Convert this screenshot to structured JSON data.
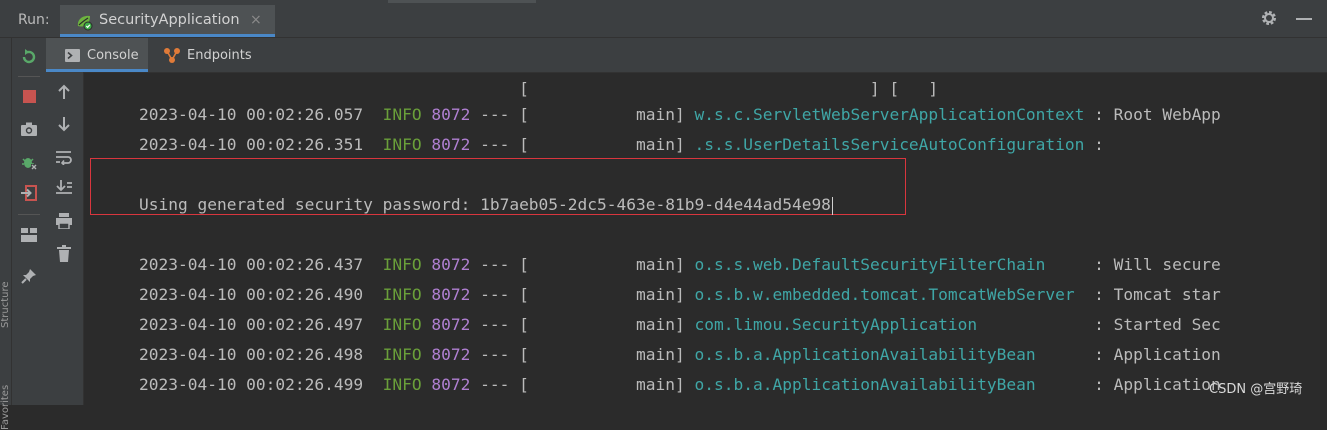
{
  "runbar": {
    "label": "Run:",
    "tab_title": "SecurityApplication",
    "close_glyph": "×"
  },
  "tabs": [
    {
      "label": "Console",
      "icon": "console-icon"
    },
    {
      "label": "Endpoints",
      "icon": "endpoints-icon"
    }
  ],
  "side_labels": [
    "Structure",
    "Favorites"
  ],
  "console": {
    "partial_top_line": "[                                   ] [   ] ",
    "lines": [
      {
        "timestamp": "2023-04-10 00:02:26.057",
        "level": "INFO",
        "pid": "8072",
        "sep": "--- [",
        "thread": "           main]",
        "logger": "w.s.c.ServletWebServerApplicationContext",
        "message": ": Root WebApp"
      },
      {
        "timestamp": "2023-04-10 00:02:26.351",
        "level": "INFO",
        "pid": "8072",
        "sep": "--- [",
        "thread": "           main]",
        "logger": ".s.s.UserDetailsServiceAutoConfiguration",
        "message": ":"
      },
      {
        "timestamp": "2023-04-10 00:02:26.437",
        "level": "INFO",
        "pid": "8072",
        "sep": "--- [",
        "thread": "           main]",
        "logger": "o.s.s.web.DefaultSecurityFilterChain    ",
        "message": ": Will secure"
      },
      {
        "timestamp": "2023-04-10 00:02:26.490",
        "level": "INFO",
        "pid": "8072",
        "sep": "--- [",
        "thread": "           main]",
        "logger": "o.s.b.w.embedded.tomcat.TomcatWebServer ",
        "message": ": Tomcat star"
      },
      {
        "timestamp": "2023-04-10 00:02:26.497",
        "level": "INFO",
        "pid": "8072",
        "sep": "--- [",
        "thread": "           main]",
        "logger": "com.limou.SecurityApplication           ",
        "message": ": Started Sec"
      },
      {
        "timestamp": "2023-04-10 00:02:26.498",
        "level": "INFO",
        "pid": "8072",
        "sep": "--- [",
        "thread": "           main]",
        "logger": "o.s.b.a.ApplicationAvailabilityBean     ",
        "message": ": Application"
      },
      {
        "timestamp": "2023-04-10 00:02:26.499",
        "level": "INFO",
        "pid": "8072",
        "sep": "--- [",
        "thread": "           main]",
        "logger": "o.s.b.a.ApplicationAvailabilityBean     ",
        "message": ": Application"
      }
    ],
    "password_line": "Using generated security password: 1b7aeb05-2dc5-463e-81b9-d4e44ad54e98"
  },
  "watermark": "CSDN @宫野琦",
  "colors": {
    "info": "#6a9f3a",
    "pid": "#b07fd1",
    "logger": "#3fa6a6",
    "highlight_border": "#d9363e",
    "tab_underline": "#4a88c7"
  }
}
